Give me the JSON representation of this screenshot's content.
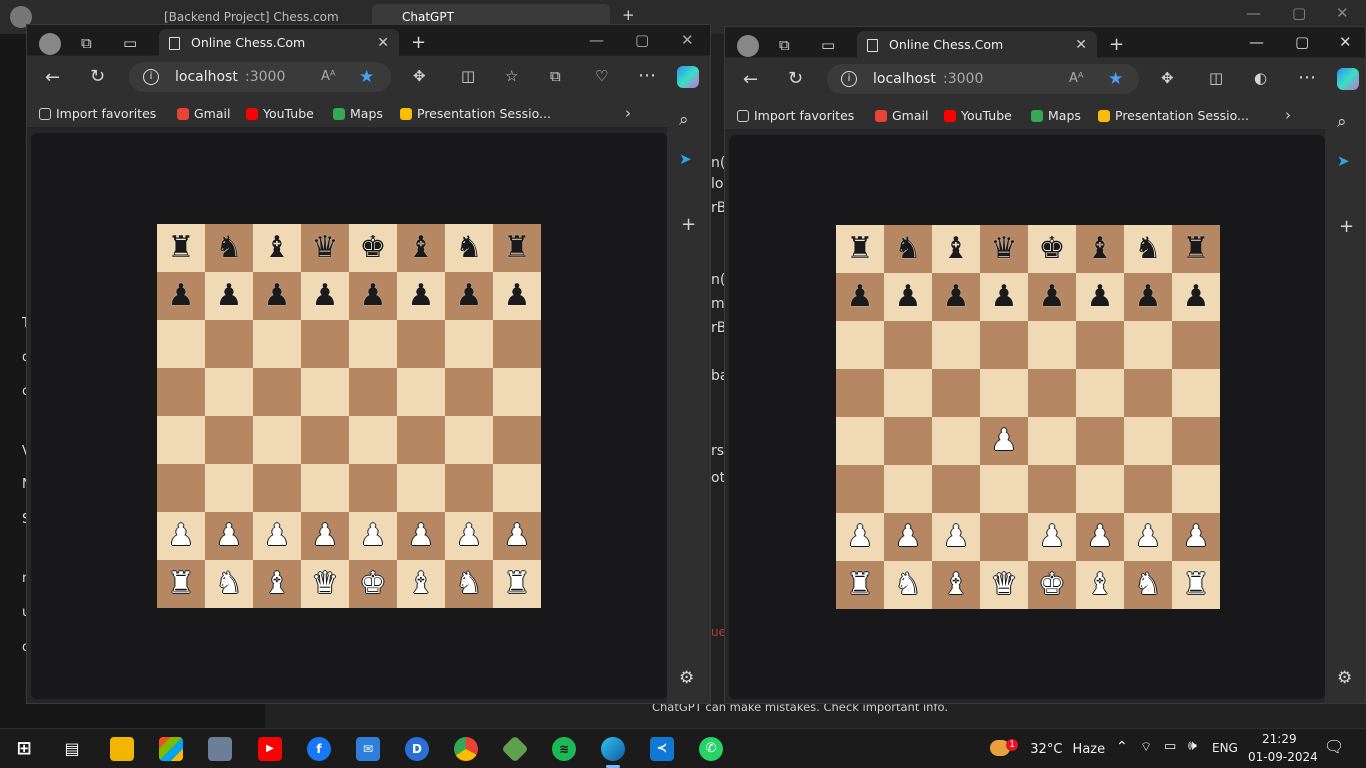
{
  "background": {
    "tabs": [
      "[Backend Project] Chess.com c",
      "ChatGPT"
    ],
    "footer": "ChatGPT can make mistakes. Check important info.",
    "fragments": [
      "n(",
      "lo",
      "rB",
      "n(",
      "m",
      "rB",
      "ba",
      "rsi",
      "ot",
      "ue"
    ],
    "side_fragments": [
      "T",
      "d",
      "c",
      "V",
      "N",
      "S",
      "n",
      "u",
      "d"
    ]
  },
  "left_browser": {
    "tab_title": "Online Chess.Com",
    "url_host": "localhost",
    "url_port": ":3000",
    "bookmarks": [
      "Import favorites",
      "Gmail",
      "YouTube",
      "Maps",
      "Presentation Sessio..."
    ],
    "board": [
      [
        "r",
        "n",
        "b",
        "q",
        "k",
        "b",
        "n",
        "r"
      ],
      [
        "p",
        "p",
        "p",
        "p",
        "p",
        "p",
        "p",
        "p"
      ],
      [
        "",
        "",
        "",
        "",
        "",
        "",
        "",
        ""
      ],
      [
        "",
        "",
        "",
        "",
        "",
        "",
        "",
        ""
      ],
      [
        "",
        "",
        "",
        "",
        "",
        "",
        "",
        ""
      ],
      [
        "",
        "",
        "",
        "",
        "",
        "",
        "",
        ""
      ],
      [
        "P",
        "P",
        "P",
        "P",
        "P",
        "P",
        "P",
        "P"
      ],
      [
        "R",
        "N",
        "B",
        "Q",
        "K",
        "B",
        "N",
        "R"
      ]
    ]
  },
  "right_browser": {
    "tab_title": "Online Chess.Com",
    "url_host": "localhost",
    "url_port": ":3000",
    "bookmarks": [
      "Import favorites",
      "Gmail",
      "YouTube",
      "Maps",
      "Presentation Sessio..."
    ],
    "board": [
      [
        "r",
        "n",
        "b",
        "q",
        "k",
        "b",
        "n",
        "r"
      ],
      [
        "p",
        "p",
        "p",
        "p",
        "p",
        "p",
        "p",
        "p"
      ],
      [
        "",
        "",
        "",
        "",
        "",
        "",
        "",
        ""
      ],
      [
        "",
        "",
        "",
        "",
        "",
        "",
        "",
        ""
      ],
      [
        "",
        "",
        "",
        "P",
        "",
        "",
        "",
        ""
      ],
      [
        "",
        "",
        "",
        "",
        "",
        "",
        "",
        ""
      ],
      [
        "P",
        "P",
        "P",
        "",
        "P",
        "P",
        "P",
        "P"
      ],
      [
        "R",
        "N",
        "B",
        "Q",
        "K",
        "B",
        "N",
        "R"
      ]
    ]
  },
  "colors": {
    "light_square": "#f0d9b5",
    "dark_square": "#b58863"
  },
  "taskbar": {
    "icons": [
      "windows-start-icon",
      "task-view-icon",
      "file-explorer-icon",
      "microsoft-store-icon",
      "camera-icon",
      "youtube-icon",
      "facebook-icon",
      "mail-icon",
      "devtools-icon",
      "chrome-icon",
      "nodejs-icon",
      "spotify-icon",
      "edge-icon",
      "vscode-icon",
      "whatsapp-icon"
    ],
    "weather_badge": "1",
    "temperature": "32°C",
    "weather": "Haze",
    "language": "ENG",
    "time": "21:29",
    "date": "01-09-2024"
  }
}
